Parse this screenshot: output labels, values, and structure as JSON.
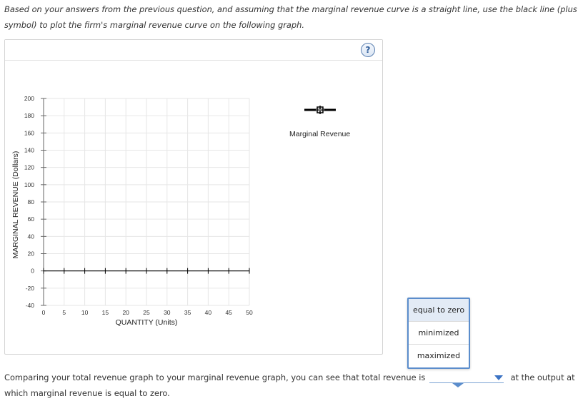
{
  "instructions": "Based on your answers from the previous question, and assuming that the marginal revenue curve is a straight line, use the black line (plus symbol) to plot the firm's marginal revenue curve on the following graph.",
  "help_button": "?",
  "legend": {
    "tool_label": "Marginal Revenue",
    "tool_icon": "plus-line-icon"
  },
  "chart_data": {
    "type": "line",
    "xlabel": "QUANTITY (Units)",
    "ylabel": "MARGINAL REVENUE (Dollars)",
    "xlim": [
      0,
      50
    ],
    "ylim": [
      -40,
      200
    ],
    "x_ticks": [
      0,
      5,
      10,
      15,
      20,
      25,
      30,
      35,
      40,
      45,
      50
    ],
    "y_ticks": [
      200,
      180,
      160,
      140,
      120,
      100,
      80,
      60,
      40,
      20,
      0,
      -20,
      -40
    ],
    "grid": true,
    "series": [
      {
        "values": [
          0,
          0,
          0,
          0,
          0,
          0,
          0,
          0,
          0,
          0,
          0
        ],
        "color": "#000000"
      }
    ]
  },
  "dropdown": {
    "options": [
      "equal to zero",
      "minimized",
      "maximized"
    ],
    "highlighted": "equal to zero"
  },
  "question": {
    "before": "Comparing your total revenue graph to your marginal revenue graph, you can see that total revenue is",
    "after": "at the output at which marginal revenue is equal to zero."
  }
}
